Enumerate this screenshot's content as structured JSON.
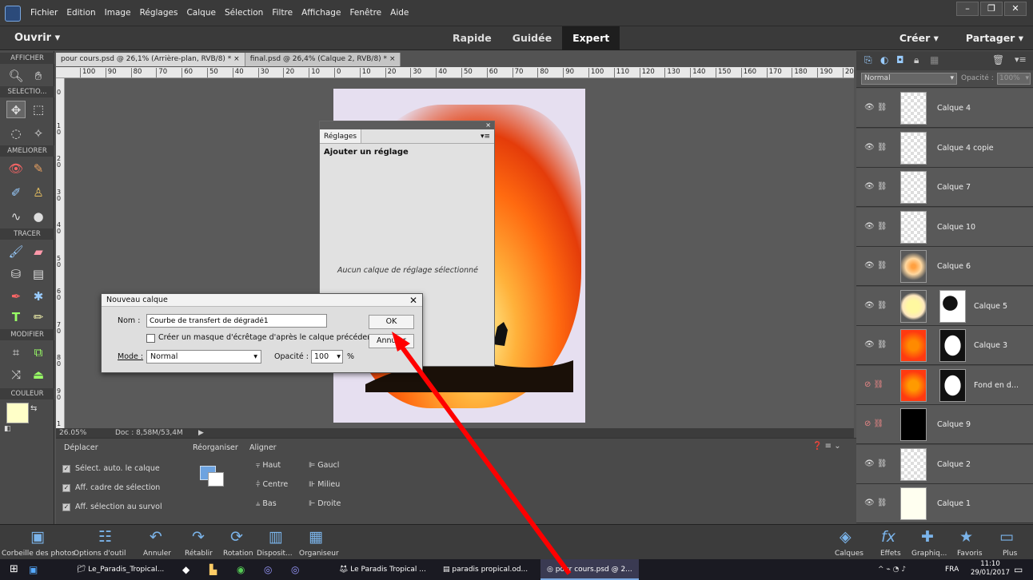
{
  "menubar": {
    "items": [
      "Fichier",
      "Edition",
      "Image",
      "Réglages",
      "Calque",
      "Sélection",
      "Filtre",
      "Affichage",
      "Fenêtre",
      "Aide"
    ]
  },
  "modebar": {
    "open_label": "Ouvrir",
    "modes": [
      "Rapide",
      "Guidée",
      "Expert"
    ],
    "active_mode": "Expert",
    "create_label": "Créer",
    "share_label": "Partager"
  },
  "toolbar": {
    "sections": [
      "AFFICHER",
      "SELECTIO...",
      "AMELIORER",
      "TRACER",
      "MODIFIER",
      "COULEUR"
    ]
  },
  "doc_tabs": [
    {
      "label": "pour cours.psd @ 26,1% (Arrière-plan, RVB/8) *",
      "close": "×"
    },
    {
      "label": "final.psd @ 26,4% (Calque 2, RVB/8) *",
      "close": "×"
    }
  ],
  "ruler": {
    "h_ticks": [
      "100",
      "90",
      "80",
      "70",
      "60",
      "50",
      "40",
      "30",
      "20",
      "10",
      "0",
      "10",
      "20",
      "30",
      "40",
      "50",
      "60",
      "70",
      "80",
      "90",
      "100",
      "110",
      "120",
      "130",
      "140",
      "150",
      "160",
      "170",
      "180",
      "190",
      "200"
    ],
    "v_ticks": [
      "0",
      "1\n0",
      "2\n0",
      "3\n0",
      "4\n0",
      "5\n0",
      "6\n0",
      "7\n0",
      "8\n0",
      "9\n0",
      "1"
    ]
  },
  "status": {
    "zoom": "26.05%",
    "doc": "Doc : 8,58M/53,4M"
  },
  "reglages_panel": {
    "tab": "Réglages",
    "heading": "Ajouter un réglage",
    "empty_msg": "Aucun calque de réglage sélectionné",
    "close": "×",
    "menu": "▾≡"
  },
  "dialog": {
    "title": "Nouveau calque",
    "name_label": "Nom :",
    "name_value": "Courbe de transfert de dégradé1",
    "clip_label": "Créer un masque d'écrêtage d'après le calque précédent",
    "mode_label": "Mode :",
    "mode_value": "Normal",
    "opacity_label": "Opacité :",
    "opacity_value": "100",
    "percent": "%",
    "ok_label": "OK",
    "cancel_label": "Annuler",
    "close": "✕"
  },
  "layers_panel": {
    "blend_mode": "Normal",
    "opacity_label": "Opacité :",
    "opacity_value": "100%",
    "layers": [
      {
        "name": "Calque 4",
        "visible": true
      },
      {
        "name": "Calque 4 copie",
        "visible": true
      },
      {
        "name": "Calque 7",
        "visible": true
      },
      {
        "name": "Calque 10",
        "visible": true
      },
      {
        "name": "Calque 6",
        "visible": true
      },
      {
        "name": "Calque 5",
        "visible": true
      },
      {
        "name": "Calque 3",
        "visible": true
      },
      {
        "name": "Fond en d...",
        "visible": false
      },
      {
        "name": "Calque 9",
        "visible": false
      },
      {
        "name": "Calque 2",
        "visible": true
      },
      {
        "name": "Calque 1",
        "visible": true
      }
    ]
  },
  "options": {
    "move_title": "Déplacer",
    "reorg_title": "Réorganiser",
    "align_title": "Aligner",
    "checks": [
      "Sélect. auto. le calque",
      "Aff. cadre de sélection",
      "Aff. sélection au survol"
    ],
    "align_col1": [
      "Haut",
      "Centre",
      "Bas"
    ],
    "align_col2": [
      "Gaucl",
      "Milieu",
      "Droite"
    ]
  },
  "dock": {
    "left": [
      "Corbeille des photos",
      "Options d'outil",
      "Annuler",
      "Rétablir",
      "Rotation",
      "Disposit...",
      "Organiseur"
    ],
    "right": [
      "Calques",
      "Effets",
      "Graphiq...",
      "Favoris",
      "Plus"
    ]
  },
  "taskbar": {
    "items": [
      "Le_Paradis_Tropical...",
      "Le Paradis Tropical ...",
      "paradis propical.od...",
      "pour cours.psd @ 2..."
    ],
    "lang": "FRA",
    "time": "11:10",
    "date": "29/01/2017"
  }
}
